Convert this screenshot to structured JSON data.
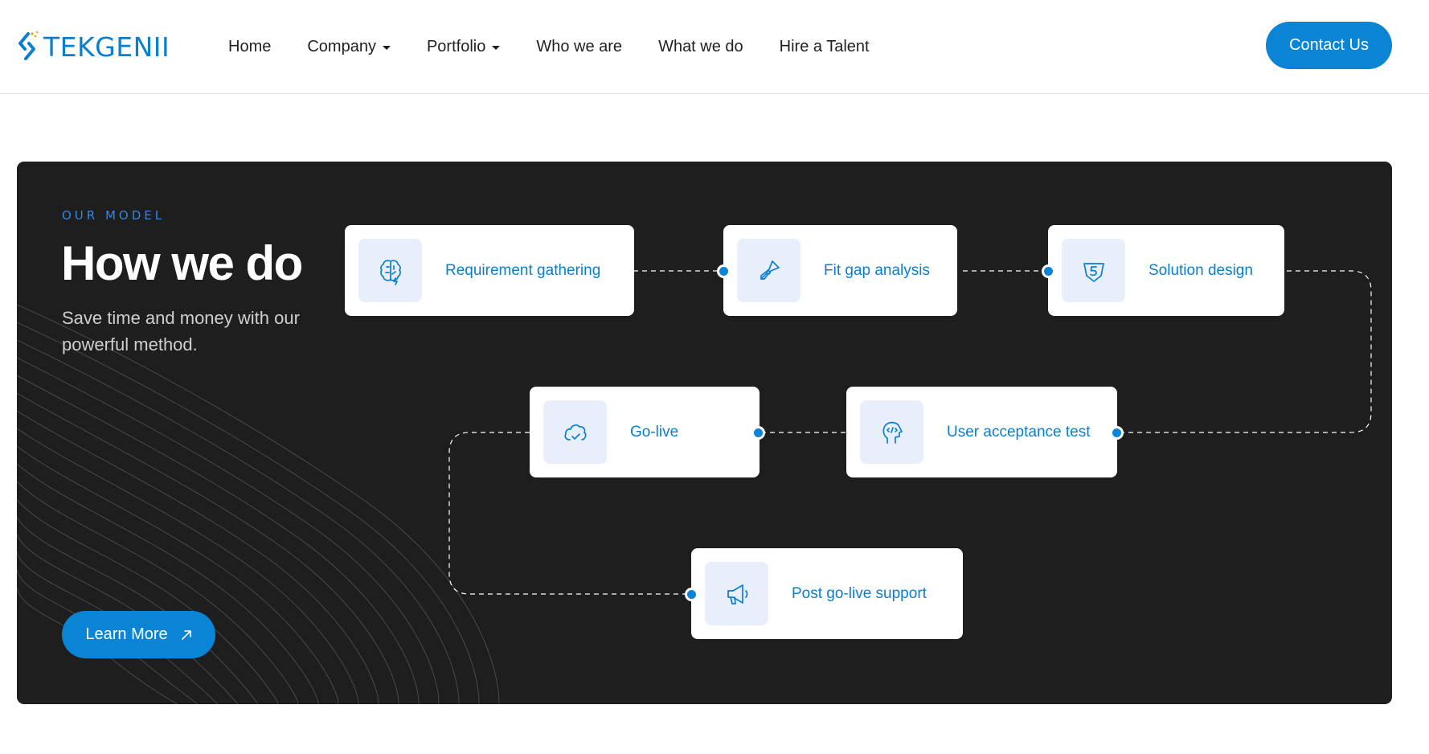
{
  "brand": {
    "name": "TEKGENII",
    "accent_color": "#0a84d4",
    "logo_mark_icon": "double-chevron-logo-icon"
  },
  "nav": {
    "items": [
      {
        "label": "Home",
        "has_dropdown": false
      },
      {
        "label": "Company",
        "has_dropdown": true
      },
      {
        "label": "Portfolio",
        "has_dropdown": true
      },
      {
        "label": "Who we are",
        "has_dropdown": false
      },
      {
        "label": "What we do",
        "has_dropdown": false
      },
      {
        "label": "Hire a Talent",
        "has_dropdown": false
      }
    ],
    "contact_label": "Contact Us"
  },
  "model": {
    "eyebrow": "OUR MODEL",
    "title": "How we do",
    "subtitle": "Save time and money with our powerful method.",
    "learn_more_label": "Learn More",
    "learn_more_icon": "arrow-up-right-icon",
    "background_color": "#1e1e1f",
    "steps": [
      {
        "label": "Requirement gathering",
        "icon": "brain-icon"
      },
      {
        "label": "Fit gap analysis",
        "icon": "pen-nib-icon"
      },
      {
        "label": "Solution design",
        "icon": "badge-five-icon"
      },
      {
        "label": "User acceptance test",
        "icon": "head-code-icon"
      },
      {
        "label": "Go-live",
        "icon": "cloud-check-icon"
      },
      {
        "label": "Post go-live support",
        "icon": "megaphone-icon"
      }
    ]
  }
}
